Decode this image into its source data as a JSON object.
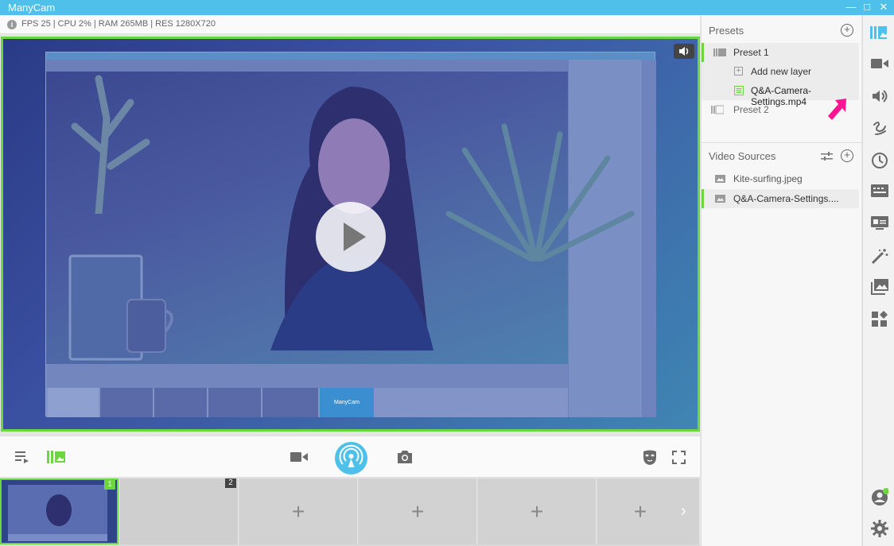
{
  "window": {
    "title": "ManyCam",
    "minimize": "—",
    "maximize": "□",
    "close": "✕"
  },
  "status": {
    "text": "FPS 25 | CPU 2% | RAM 265MB | RES 1280X720",
    "info_icon": "info-icon"
  },
  "preview": {
    "inner_logo": "ManyCam",
    "play_icon": "play-icon",
    "volume_icon": "volume-icon"
  },
  "controls": {
    "left": [
      "playlist-icon",
      "layers-icon"
    ],
    "center": [
      "camera-icon",
      "broadcast-icon",
      "snapshot-icon"
    ],
    "right": [
      "mask-icon",
      "fullscreen-icon"
    ]
  },
  "strip": {
    "slots": [
      {
        "badge": "1",
        "content": "",
        "filled": true
      },
      {
        "badge": "2",
        "content": "",
        "filled": false
      },
      {
        "badge": "",
        "content": "+"
      },
      {
        "badge": "",
        "content": "+"
      },
      {
        "badge": "",
        "content": "+"
      },
      {
        "badge": "",
        "content": "+"
      }
    ],
    "next": "›"
  },
  "presets": {
    "header": "Presets",
    "items": [
      {
        "label": "Preset 1"
      },
      {
        "label": "Add new layer"
      },
      {
        "label": "Q&A-Camera-Settings.mp4"
      },
      {
        "label": "Preset 2"
      }
    ]
  },
  "video_sources": {
    "header": "Video Sources",
    "items": [
      {
        "label": "Kite-surfing.jpeg"
      },
      {
        "label": "Q&A-Camera-Settings...."
      }
    ]
  },
  "rail": {
    "icons": [
      "presets-icon",
      "camera-icon",
      "audio-icon",
      "draw-icon",
      "clock-icon",
      "subtitles-icon",
      "display-icon",
      "effects-icon",
      "image-icon",
      "widgets-icon",
      "account-icon",
      "settings-icon"
    ]
  },
  "colors": {
    "accent": "#4ec0e9",
    "active": "#6cd63f",
    "pointer": "#ff1493"
  }
}
